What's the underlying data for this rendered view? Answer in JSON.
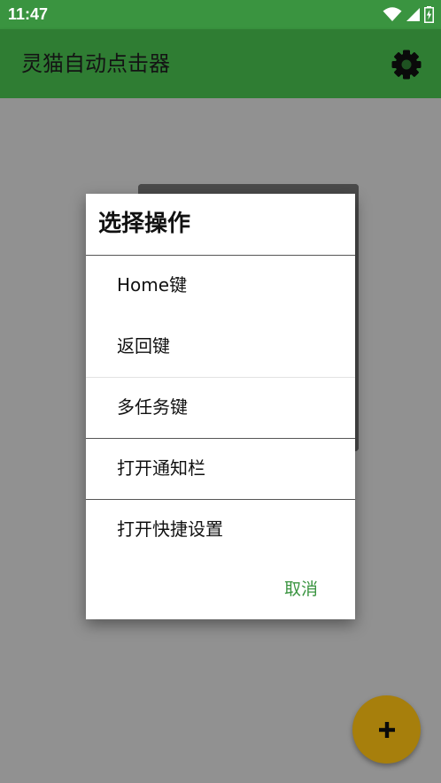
{
  "status_bar": {
    "time": "11:47"
  },
  "app_bar": {
    "title": "灵猫自动点击器",
    "settings_icon": "gear-icon"
  },
  "dialog": {
    "title": "选择操作",
    "items": [
      {
        "label": "Home键"
      },
      {
        "label": "返回键"
      },
      {
        "label": "多任务键"
      },
      {
        "label": "打开通知栏"
      },
      {
        "label": "打开快捷设置"
      }
    ],
    "cancel_label": "取消"
  },
  "fab": {
    "icon": "plus-icon"
  },
  "colors": {
    "status_bar": "#3a9440",
    "app_bar": "#2f7d33",
    "accent": "#3a9440",
    "fab": "#a77f0c"
  }
}
